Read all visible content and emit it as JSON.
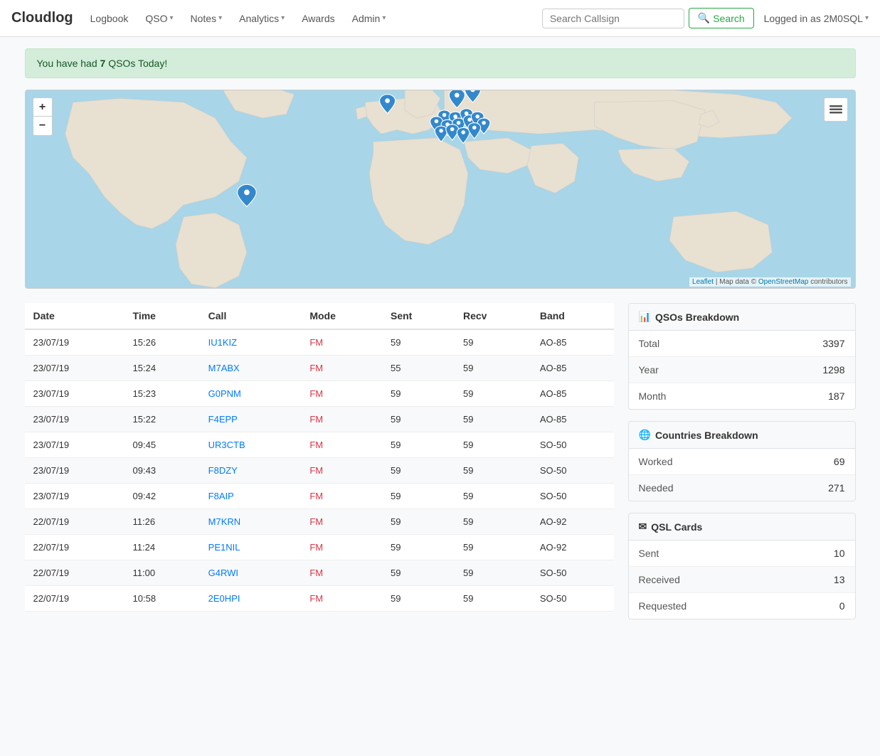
{
  "app": {
    "brand": "Cloudlog"
  },
  "navbar": {
    "logbook_label": "Logbook",
    "qso_label": "QSO",
    "notes_label": "Notes",
    "analytics_label": "Analytics",
    "awards_label": "Awards",
    "admin_label": "Admin",
    "search_placeholder": "Search Callsign",
    "search_button": "Search",
    "logged_in": "Logged in as 2M0SQL"
  },
  "alert": {
    "prefix": "You have had ",
    "count": "7",
    "suffix": " QSOs Today!"
  },
  "map": {
    "attribution_leaflet": "Leaflet",
    "attribution_map": " | Map data © ",
    "attribution_osm": "OpenStreetMap",
    "attribution_contributors": " contributors",
    "zoom_in": "+",
    "zoom_out": "−"
  },
  "table": {
    "headers": [
      "Date",
      "Time",
      "Call",
      "Mode",
      "Sent",
      "Recv",
      "Band"
    ],
    "rows": [
      {
        "date": "23/07/19",
        "time": "15:26",
        "call": "IU1KIZ",
        "mode": "FM",
        "sent": "59",
        "recv": "59",
        "band": "AO-85"
      },
      {
        "date": "23/07/19",
        "time": "15:24",
        "call": "M7ABX",
        "mode": "FM",
        "sent": "55",
        "recv": "59",
        "band": "AO-85"
      },
      {
        "date": "23/07/19",
        "time": "15:23",
        "call": "G0PNM",
        "mode": "FM",
        "sent": "59",
        "recv": "59",
        "band": "AO-85"
      },
      {
        "date": "23/07/19",
        "time": "15:22",
        "call": "F4EPP",
        "mode": "FM",
        "sent": "59",
        "recv": "59",
        "band": "AO-85"
      },
      {
        "date": "23/07/19",
        "time": "09:45",
        "call": "UR3CTB",
        "mode": "FM",
        "sent": "59",
        "recv": "59",
        "band": "SO-50"
      },
      {
        "date": "23/07/19",
        "time": "09:43",
        "call": "F8DZY",
        "mode": "FM",
        "sent": "59",
        "recv": "59",
        "band": "SO-50"
      },
      {
        "date": "23/07/19",
        "time": "09:42",
        "call": "F8AIP",
        "mode": "FM",
        "sent": "59",
        "recv": "59",
        "band": "SO-50"
      },
      {
        "date": "22/07/19",
        "time": "11:26",
        "call": "M7KRN",
        "mode": "FM",
        "sent": "59",
        "recv": "59",
        "band": "AO-92"
      },
      {
        "date": "22/07/19",
        "time": "11:24",
        "call": "PE1NIL",
        "mode": "FM",
        "sent": "59",
        "recv": "59",
        "band": "AO-92"
      },
      {
        "date": "22/07/19",
        "time": "11:00",
        "call": "G4RWI",
        "mode": "FM",
        "sent": "59",
        "recv": "59",
        "band": "SO-50"
      },
      {
        "date": "22/07/19",
        "time": "10:58",
        "call": "2E0HPI",
        "mode": "FM",
        "sent": "59",
        "recv": "59",
        "band": "SO-50"
      }
    ]
  },
  "qsos_breakdown": {
    "title": "QSOs Breakdown",
    "rows": [
      {
        "label": "Total",
        "value": "3397"
      },
      {
        "label": "Year",
        "value": "1298"
      },
      {
        "label": "Month",
        "value": "187"
      }
    ]
  },
  "countries_breakdown": {
    "title": "Countries Breakdown",
    "rows": [
      {
        "label": "Worked",
        "value": "69"
      },
      {
        "label": "Needed",
        "value": "271"
      }
    ]
  },
  "qsl_cards": {
    "title": "QSL Cards",
    "rows": [
      {
        "label": "Sent",
        "value": "10"
      },
      {
        "label": "Received",
        "value": "13"
      },
      {
        "label": "Requested",
        "value": "0"
      }
    ]
  }
}
